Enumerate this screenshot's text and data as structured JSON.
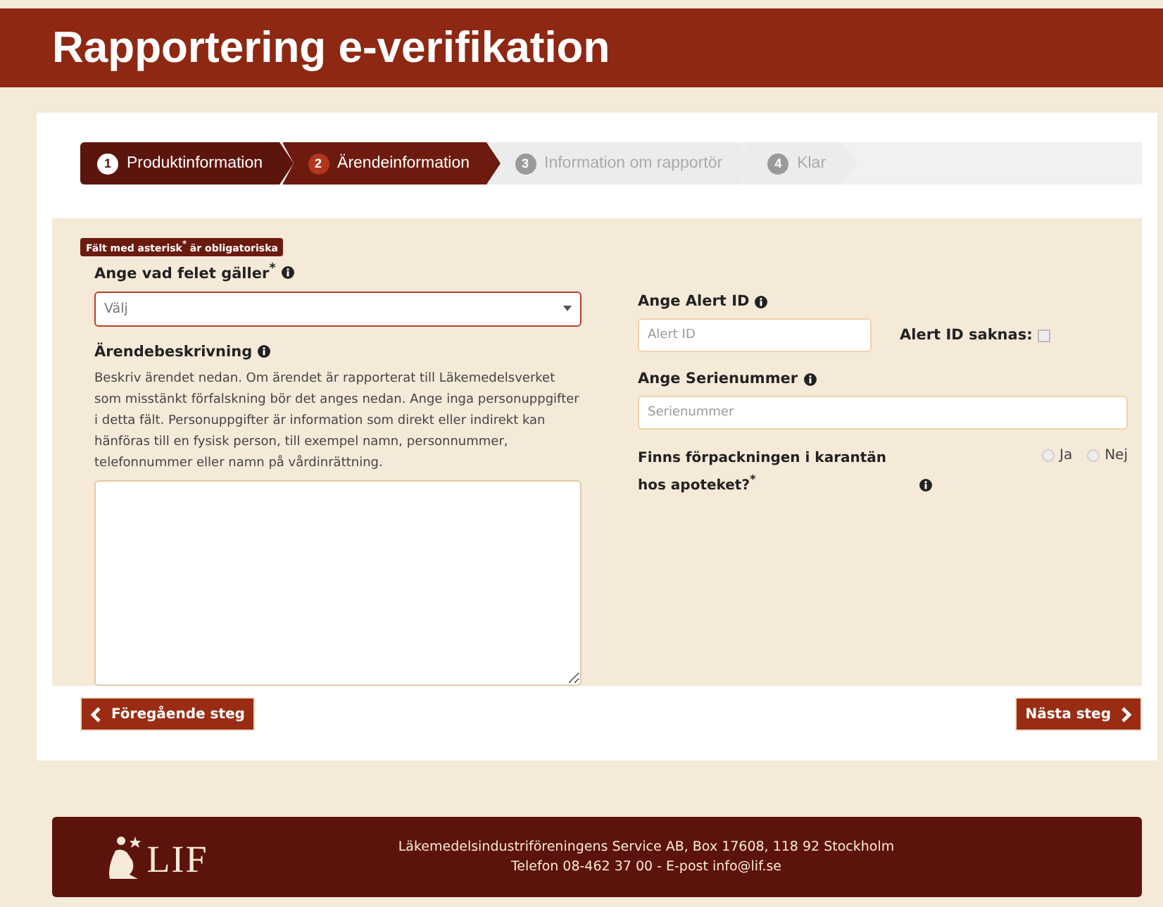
{
  "header": {
    "title": "Rapportering e-verifikation"
  },
  "steps": [
    {
      "number": "1",
      "label": "Produktinformation",
      "completed": true,
      "selected": false
    },
    {
      "number": "2",
      "label": "Ärendeinformation",
      "completed": false,
      "selected": true
    },
    {
      "number": "3",
      "label": "Information om rapportör",
      "completed": false,
      "selected": false
    },
    {
      "number": "4",
      "label": "Klar",
      "completed": false,
      "selected": false
    }
  ],
  "required_note": "Fält med asterisk$^{*}$ är obligatoriska",
  "left": {
    "type_label": "Ange vad felet gäller$^{*}$",
    "type_value": "Välj",
    "description_label": "Ärendebeskrivning",
    "description_help": "Beskriv ärendet nedan. Om ärendet är rapporterat till Läkemedelsverket som misstänkt förfalskning bör det anges nedan. Ange inga personuppgifter i detta fält. Personuppgifter är information som direkt eller indirekt kan hänföras till en fysisk person, till exempel namn, personnummer, telefonnummer eller namn på vårdinrättning."
  },
  "right": {
    "alert_label": "Ange Alert ID",
    "alert_placeholder": "Alert ID",
    "missing_label": "Alert ID saknas:",
    "missing_checked": false,
    "serial_label": "Ange Serienummer",
    "serial_placeholder": "Serienummer",
    "quarantine_label": "Finns förpackningen i karantän hos apoteket?$^{*}$",
    "quarantine_options": [
      {
        "label": "Ja",
        "selected": false
      },
      {
        "label": "Nej",
        "selected": false
      }
    ]
  },
  "buttons": {
    "previous": "Föregående steg",
    "next": "Nästa steg"
  },
  "footer": {
    "logo": "LIF",
    "line_1": "Läkemedelsindustriföreningens Service AB, Box 17608, 118 92 Stockholm",
    "line_2": "Telefon 08-462 37 00 - E-post info@lif.se"
  }
}
